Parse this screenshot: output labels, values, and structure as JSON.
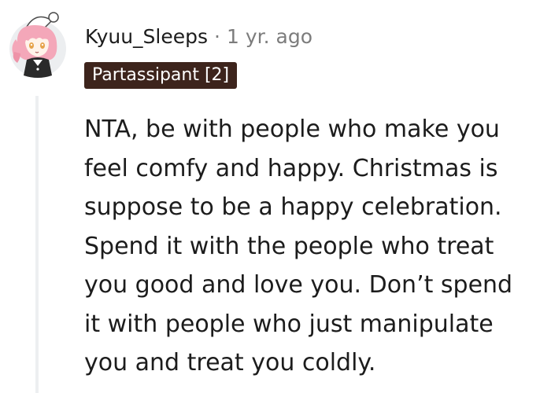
{
  "comment": {
    "author": "Kyuu_Sleeps",
    "separator": "·",
    "age": "1 yr. ago",
    "flair": "Partassipant [2]",
    "avatar_icon": "anime-girl-avatar-icon",
    "body": "NTA, be with people who make you\nfeel comfy and happy. Christmas is\nsuppose to be a happy celebration.\nSpend it with the people who treat\nyou good and love you. Don’t spend\nit with people who just manipulate\nyou and treat you coldly."
  },
  "colors": {
    "text": "#1c1c1c",
    "meta": "#7c7c7c",
    "flair_bg": "#3d241c",
    "flair_text": "#ffffff",
    "thread_line": "#edeff1"
  }
}
